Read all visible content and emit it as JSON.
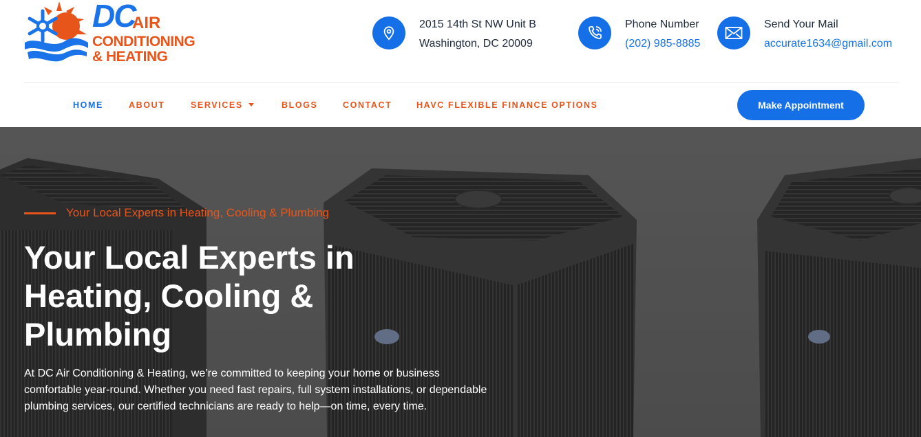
{
  "logo": {
    "dc": "DC",
    "air": "AIR",
    "line1": "CONDITIONING",
    "line2": "& HEATING"
  },
  "contacts": [
    {
      "icon": "map-pin-icon",
      "line1": "2015 14th St NW Unit B",
      "line2": "Washington, DC 20009"
    },
    {
      "icon": "phone-icon",
      "line1": "Phone Number",
      "line2": "(202) 985-8885"
    },
    {
      "icon": "mail-icon",
      "line1": "Send Your Mail",
      "line2": "accurate1634@gmail.com"
    }
  ],
  "nav": {
    "items": [
      "HOME",
      "ABOUT",
      "SERVICES",
      "BLOGS",
      "CONTACT",
      "HAVC FLEXIBLE FINANCE OPTIONS"
    ],
    "active": "HOME",
    "cta": "Make Appointment"
  },
  "hero": {
    "eyebrow": "Your Local Experts in Heating, Cooling & Plumbing",
    "title_line1": "Your Local Experts in",
    "title_line2": "Heating, Cooling &",
    "title_line3": "Plumbing",
    "text_line1": "At DC Air Conditioning & Heating, we’re committed to keeping your home or business",
    "text_line2": "comfortable year-round. Whether you need fast repairs, full system installations, or dependable",
    "text_line3": "plumbing services, our certified technicians are ready to help—on time, every time."
  },
  "colors": {
    "brand_blue": "#1570e8",
    "brand_orange": "#e8551b",
    "text_dark": "#1e2a3b"
  }
}
